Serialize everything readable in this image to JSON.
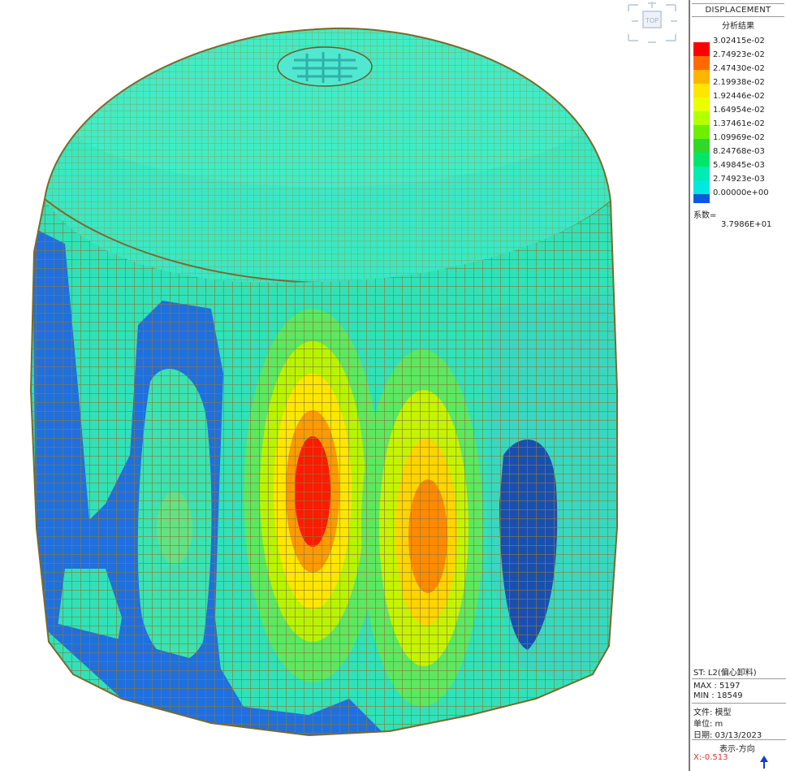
{
  "panel": {
    "title": "DISPLACEMENT",
    "subtitle": "分析结果",
    "legend_values": [
      "3.02415e-02",
      "2.74923e-02",
      "2.47430e-02",
      "2.19938e-02",
      "1.92446e-02",
      "1.64954e-02",
      "1.37461e-02",
      "1.09969e-02",
      "8.24768e-03",
      "5.49845e-03",
      "2.74923e-03",
      "0.00000e+00"
    ],
    "legend_colors": [
      "#ff0000",
      "#ff6a00",
      "#ffb400",
      "#ffe600",
      "#eaff00",
      "#b4ff00",
      "#6cf000",
      "#2fd82a",
      "#00e66a",
      "#00ecb0",
      "#00e8e0",
      "#0a5adf"
    ],
    "factor_label": "系数=",
    "factor_value": "3.7986E+01",
    "st": "ST: L2(偏心卸料)",
    "max": "MAX : 5197",
    "min": "MIN : 18549",
    "file": "文件: 模型",
    "unit": "单位: m",
    "date": "日期: 03/13/2023",
    "view_dir": "表示-方向",
    "x_dir": "X:-0.513"
  },
  "viewcube": {
    "label": "TOP"
  }
}
